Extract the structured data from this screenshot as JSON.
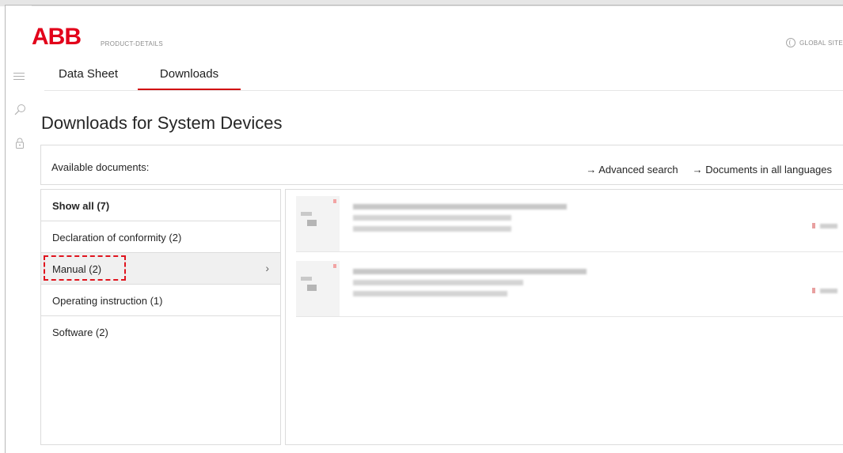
{
  "header": {
    "brand": "ABB",
    "section_label": "PRODUCT-DETAILS",
    "global_label": "GLOBAL SITE"
  },
  "tabs": [
    {
      "label": "Data Sheet",
      "active": false
    },
    {
      "label": "Downloads",
      "active": true
    }
  ],
  "page": {
    "title": "Downloads for System Devices"
  },
  "documents_bar": {
    "available_label": "Available documents:",
    "advanced_search": "→ Advanced search",
    "all_languages": "→ Documents in all languages"
  },
  "categories": [
    {
      "label": "Show all (7)",
      "bold": true
    },
    {
      "label": "Declaration of conformity (2)"
    },
    {
      "label": "Manual (2)",
      "selected": true,
      "chevron": "›"
    },
    {
      "label": "Operating instruction (1)"
    },
    {
      "label": "Software (2)"
    }
  ],
  "colors": {
    "accent": "#d10a10",
    "highlight": "#e0141e",
    "selected_bg": "#f0f0f0"
  },
  "icons": [
    "hamburger-icon",
    "search-icon",
    "lock-icon",
    "globe-icon",
    "chevron-right-icon"
  ]
}
